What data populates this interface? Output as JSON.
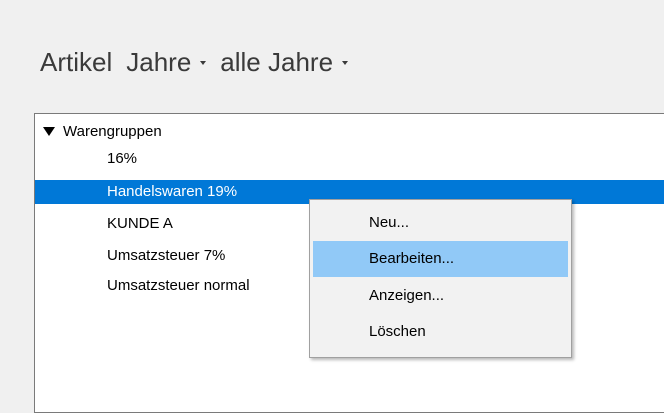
{
  "header": {
    "title": "Artikel",
    "filter_type": "Jahre",
    "filter_value": "alle Jahre",
    "caret_icon": "chevron-down-icon"
  },
  "tree": {
    "root_label": "Warengruppen",
    "expand_icon": "triangle-down-icon",
    "items": [
      {
        "label": "16%"
      },
      {
        "label": "Handelswaren 19%",
        "selected": true
      },
      {
        "label": "KUNDE A"
      },
      {
        "label": "Umsatzsteuer 7%"
      },
      {
        "label": "Umsatzsteuer normal"
      }
    ],
    "selection_color": "#0078d7"
  },
  "context_menu": {
    "items": [
      {
        "label": "Neu..."
      },
      {
        "label": "Bearbeiten...",
        "hovered": true
      },
      {
        "label": "Anzeigen..."
      },
      {
        "label": "Löschen"
      }
    ],
    "hover_color": "#91c9f7"
  }
}
